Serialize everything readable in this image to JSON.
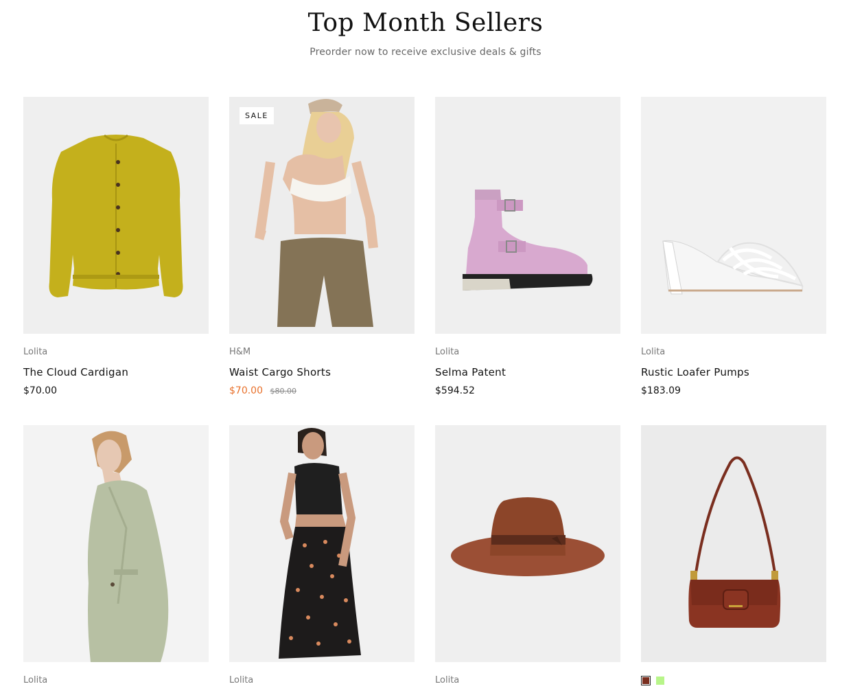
{
  "section": {
    "title": "Top Month Sellers",
    "subtitle": "Preorder now to receive exclusive deals & gifts"
  },
  "products": [
    {
      "brand": "Lolita",
      "name": "The Cloud Cardigan",
      "price": "$70.00",
      "image": "yellow-cardigan"
    },
    {
      "brand": "H&M",
      "name": "Waist Cargo Shorts",
      "price": "$70.00",
      "compare_price": "$80.00",
      "badge": "SALE",
      "image": "model-cargo-shorts"
    },
    {
      "brand": "Lolita",
      "name": "Selma Patent",
      "price": "$594.52",
      "image": "pink-patent-boot"
    },
    {
      "brand": "Lolita",
      "name": "Rustic Loafer Pumps",
      "price": "$183.09",
      "image": "white-heeled-sandal"
    },
    {
      "brand": "Lolita",
      "image": "model-sage-blazer"
    },
    {
      "brand": "Lolita",
      "image": "model-floral-skirt"
    },
    {
      "brand": "Lolita",
      "image": "brown-fedora-hat"
    },
    {
      "image": "brown-shoulder-bag",
      "swatches": [
        "#7a2e1f",
        "#b8f58a"
      ]
    }
  ],
  "colors": {
    "sale": "#e8702a",
    "text": "#111111",
    "muted": "#777777",
    "image_bg": "#efefef"
  }
}
